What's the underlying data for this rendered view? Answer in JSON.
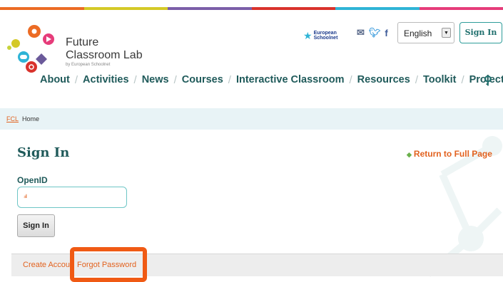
{
  "colors": {
    "stripe": [
      "#ec6b24",
      "#d4c926",
      "#7b5ea8",
      "#d9322c",
      "#2fb4d6",
      "#e63c7a"
    ],
    "accent_orange": "#e2621f",
    "teal_dark": "#1f5a5a",
    "highlight": "#f05a14"
  },
  "logo": {
    "line1": "Future",
    "line2": "Classroom Lab",
    "sub": "by European Schoolnet"
  },
  "header": {
    "eun_line1": "European",
    "eun_line2": "Schoolnet",
    "language": "English",
    "signin_label": "Sign In",
    "social_icons": [
      "mail-icon",
      "twitter-icon",
      "facebook-icon"
    ]
  },
  "nav": {
    "items": [
      "About",
      "Activities",
      "News",
      "Courses",
      "Interactive Classroom",
      "Resources",
      "Toolkit",
      "Projects"
    ],
    "separator": "/"
  },
  "breadcrumb": {
    "root": "FCL",
    "current": "Home"
  },
  "main": {
    "title": "Sign In",
    "return_link": "Return to Full Page",
    "openid_label": "OpenID",
    "openid_value": "",
    "signin_button": "Sign In"
  },
  "footer_links": {
    "create_account": "Create Account",
    "forgot_password": "Forgot Password"
  }
}
